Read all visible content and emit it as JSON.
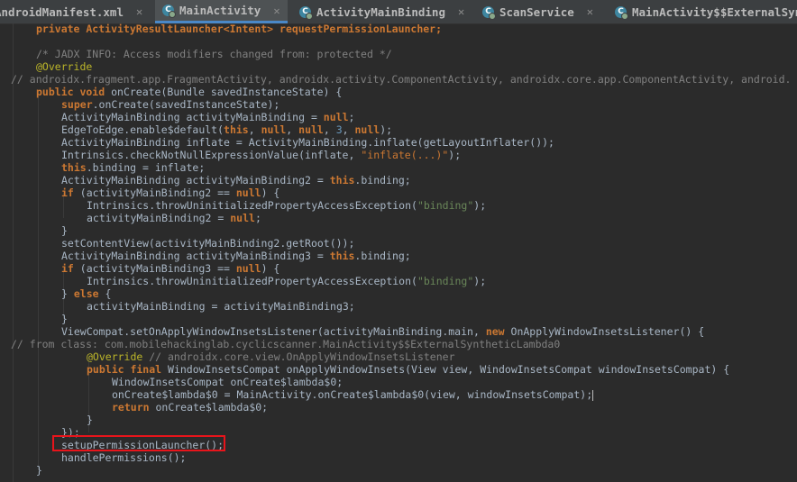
{
  "tabs": [
    {
      "label": "AndroidManifest.xml",
      "close": "✕",
      "icon": ""
    },
    {
      "label": "MainActivity",
      "close": "✕",
      "icon": "C"
    },
    {
      "label": "ActivityMainBinding",
      "close": "✕",
      "icon": "C"
    },
    {
      "label": "ScanService",
      "close": "✕",
      "icon": "C"
    },
    {
      "label": "MainActivity$$ExternalSynt",
      "close": "",
      "icon": "C"
    }
  ],
  "code": {
    "l0a": "private ActivityResultLauncher<Intent> requestPermissionLauncher;",
    "l1": "/* JADX INFO: Access modifiers changed from: protected */",
    "l2": "@Override",
    "l3": "// androidx.fragment.app.FragmentActivity, androidx.activity.ComponentActivity, androidx.core.app.ComponentActivity, android.",
    "l4_kw": "public void",
    "l4_rest": " onCreate(Bundle savedInstanceState) {",
    "l5_kw": "super",
    "l5_rest": ".onCreate(savedInstanceState);",
    "l6_a": "ActivityMainBinding activityMainBinding = ",
    "l6_kw": "null",
    "l7_a": "EdgeToEdge.enable$default(",
    "l7_kw1": "this",
    "l7_kw2": "null",
    "l7_kw3": "null",
    "l7_num": "3",
    "l7_kw4": "null",
    "l7_end": ");",
    "l8": "ActivityMainBinding inflate = ActivityMainBinding.inflate(getLayoutInflater());",
    "l9_a": "Intrinsics.checkNotNullExpressionValue(inflate, ",
    "l9_str": "\"inflate(...)\"",
    "l9_end": ");",
    "l10_kw": "this",
    "l10_rest": ".binding = inflate;",
    "l11_a": "ActivityMainBinding activityMainBinding2 = ",
    "l11_kw": "this",
    "l11_rest": ".binding;",
    "l12_kw": "if",
    "l12_a": " (activityMainBinding2 == ",
    "l12_kw2": "null",
    "l12_end": ") {",
    "l13_a": "Intrinsics.throwUninitializedPropertyAccessException(",
    "l13_str": "\"binding\"",
    "l13_end": ");",
    "l14_a": "activityMainBinding2 = ",
    "l14_kw": "null",
    "l15": "}",
    "l16": "setContentView(activityMainBinding2.getRoot());",
    "l17_a": "ActivityMainBinding activityMainBinding3 = ",
    "l17_kw": "this",
    "l17_rest": ".binding;",
    "l18_kw": "if",
    "l18_a": " (activityMainBinding3 == ",
    "l18_kw2": "null",
    "l18_end": ") {",
    "l19_a": "Intrinsics.throwUninitializedPropertyAccessException(",
    "l19_str": "\"binding\"",
    "l19_end": ");",
    "l20_a": "} ",
    "l20_kw": "else",
    "l20_end": " {",
    "l21": "activityMainBinding = activityMainBinding3;",
    "l22": "}",
    "l23_a": "ViewCompat.setOnApplyWindowInsetsListener(activityMainBinding.main, ",
    "l23_kw": "new",
    "l23_end": " OnApplyWindowInsetsListener() {",
    "l24": "// from class: com.mobilehackinglab.cyclicscanner.MainActivity$$ExternalSyntheticLambda0",
    "l25_an": "@Override",
    "l25_cm": " // androidx.core.view.OnApplyWindowInsetsListener",
    "l26_kw": "public final",
    "l26_rest": " WindowInsetsCompat onApplyWindowInsets(View view, WindowInsetsCompat windowInsetsCompat) {",
    "l27": "WindowInsetsCompat onCreate$lambda$0;",
    "l28": "onCreate$lambda$0 = MainActivity.onCreate$lambda$0(view, windowInsetsCompat);",
    "l29_kw": "return",
    "l29_rest": " onCreate$lambda$0;",
    "l30": "}",
    "l31": "});",
    "l32": "setupPermissionLauncher();",
    "l33": "handlePermissions();",
    "l34": "}"
  },
  "colors": {
    "background": "#2b2b2b",
    "keyword": "#cc7832",
    "string": "#6a8759",
    "comment": "#808080",
    "annotation": "#bbb529",
    "highlight": "#e8141b"
  }
}
